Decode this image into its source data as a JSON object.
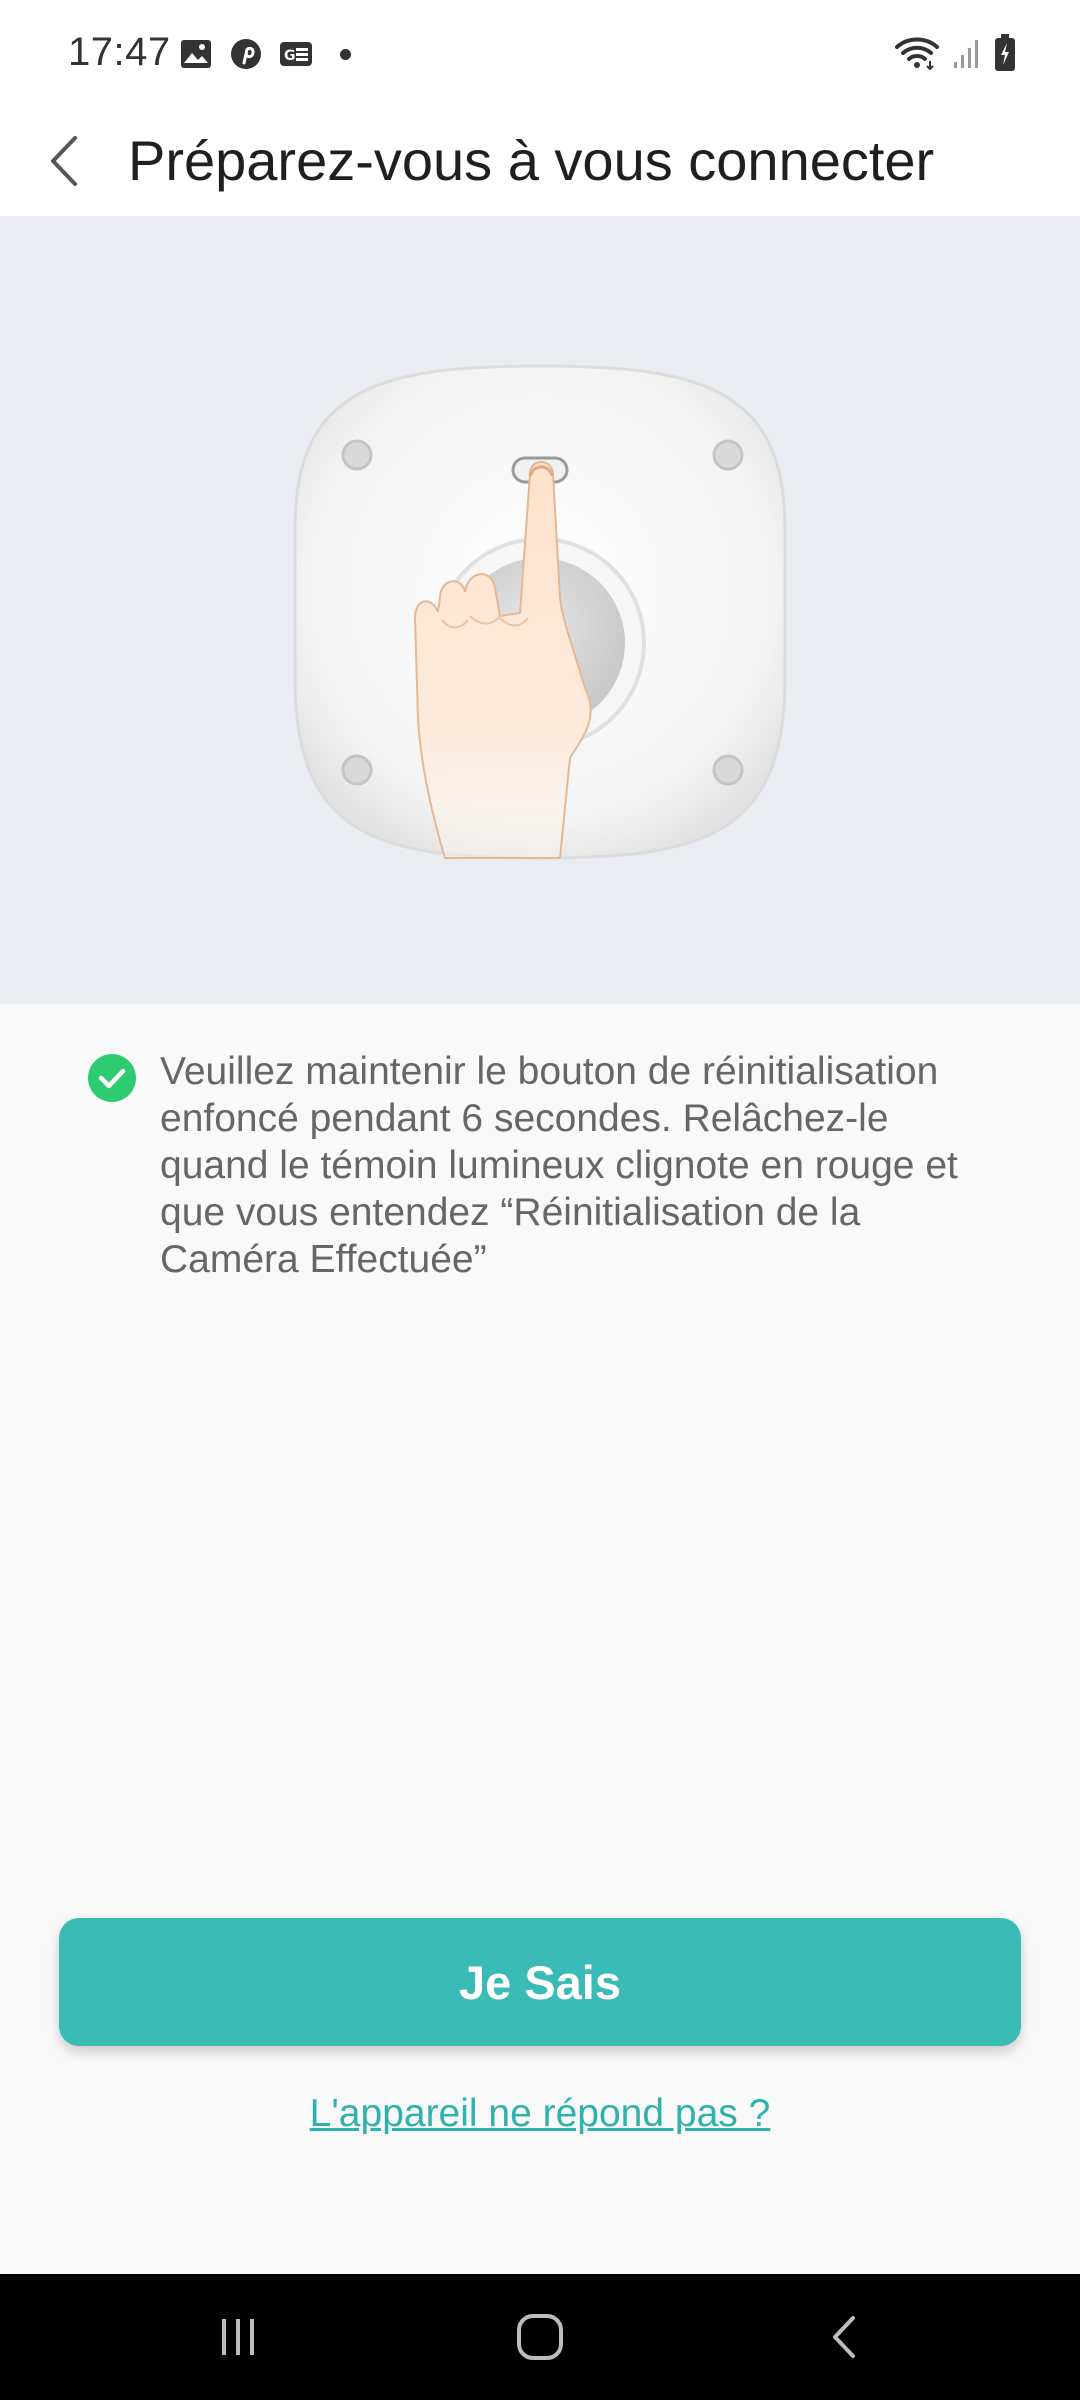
{
  "status_bar": {
    "time": "17:47",
    "left_icons": [
      "gallery-icon",
      "pinterest-icon",
      "news-icon"
    ],
    "right_icons": [
      "wifi-icon",
      "signal-icon",
      "battery-charging-icon"
    ]
  },
  "header": {
    "back_icon": "chevron-left-icon",
    "title": "Préparez-vous à vous connecter"
  },
  "illustration": {
    "subject": "hand pressing reset button on camera"
  },
  "instruction": {
    "icon": "check-circle-icon",
    "text": "Veuillez maintenir le bouton de réinitialisation enfoncé pendant 6 secondes. Relâchez-le quand le témoin lumineux clignote en rouge et que vous entendez “Réinitialisation de la Caméra Effectuée”"
  },
  "actions": {
    "primary_label": "Je Sais",
    "help_link": "L'appareil ne répond pas ?"
  },
  "nav_bar": {
    "items": [
      "recent-apps-icon",
      "home-icon",
      "back-icon"
    ]
  },
  "colors": {
    "accent": "#3bbbb6",
    "link": "#2fb1ad",
    "check": "#2ecc71",
    "illustration_bg": "#e9ecf1"
  }
}
